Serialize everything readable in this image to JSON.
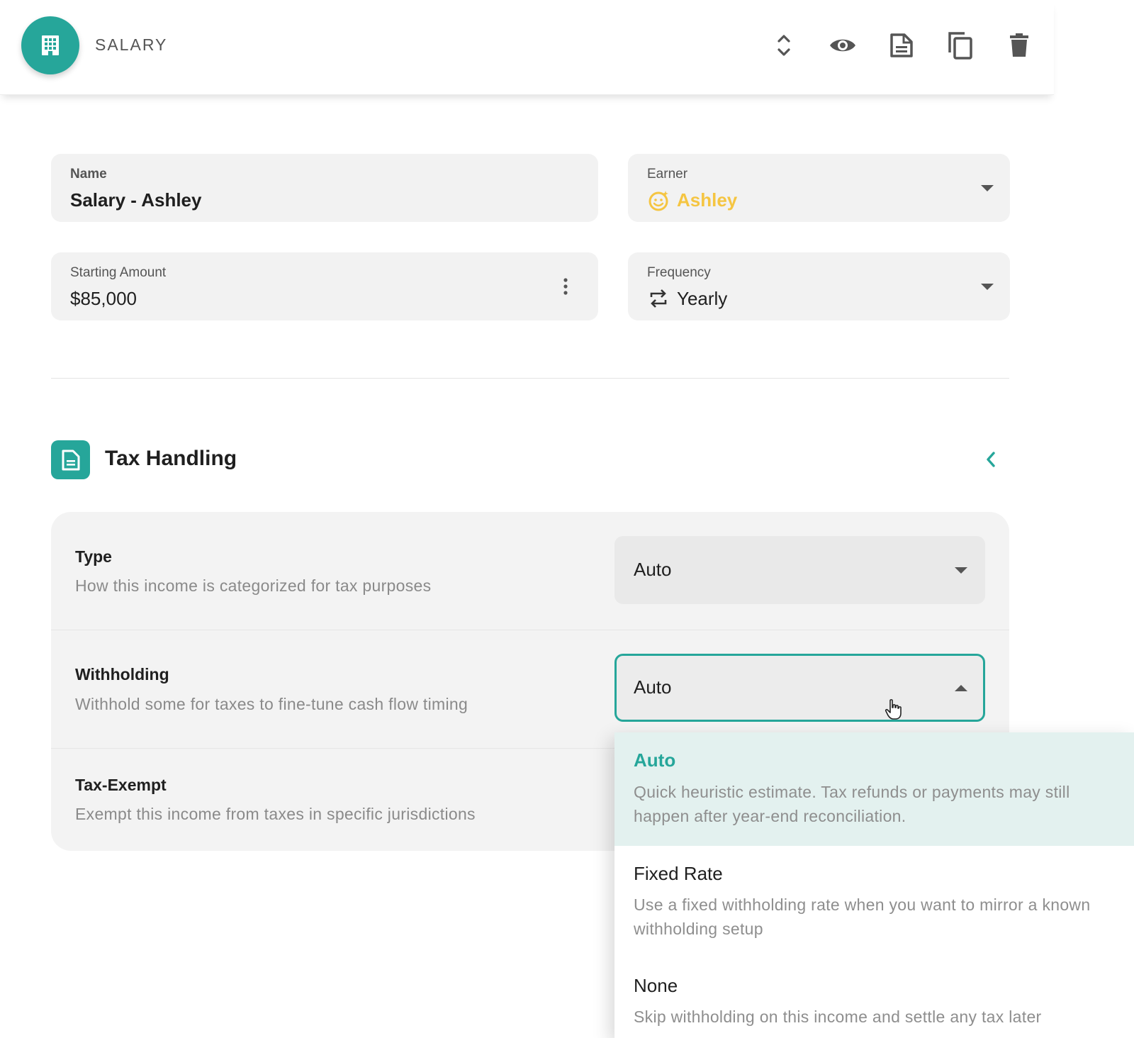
{
  "header": {
    "title": "SALARY",
    "app_icon": "building-icon",
    "actions": [
      {
        "name": "expand-collapse",
        "icon": "unfold-icon"
      },
      {
        "name": "preview",
        "icon": "eye-icon"
      },
      {
        "name": "notes",
        "icon": "document-icon"
      },
      {
        "name": "duplicate",
        "icon": "copy-icon"
      },
      {
        "name": "delete",
        "icon": "trash-icon"
      }
    ]
  },
  "form": {
    "name": {
      "label": "Name",
      "value": "Salary - Ashley"
    },
    "earner": {
      "label": "Earner",
      "value": "Ashley",
      "icon": "smiley-icon",
      "color": "#f5c542"
    },
    "starting_amount": {
      "label": "Starting Amount",
      "value": "$85,000"
    },
    "frequency": {
      "label": "Frequency",
      "value": "Yearly",
      "icon": "repeat-icon"
    }
  },
  "tax_handling": {
    "title": "Tax Handling",
    "rows": [
      {
        "title": "Type",
        "description": "How this income is categorized for tax purposes",
        "value": "Auto"
      },
      {
        "title": "Withholding",
        "description": "Withhold some for taxes to fine-tune cash flow timing",
        "value": "Auto"
      },
      {
        "title": "Tax-Exempt",
        "description": "Exempt this income from taxes in specific jurisdictions"
      }
    ]
  },
  "withholding_menu": {
    "options": [
      {
        "title": "Auto",
        "description": "Quick heuristic estimate. Tax refunds or payments may still happen after year-end reconciliation.",
        "selected": true
      },
      {
        "title": "Fixed Rate",
        "description": "Use a fixed withholding rate when you want to mirror a known withholding setup",
        "selected": false
      },
      {
        "title": "None",
        "description": "Skip withholding on this income and settle any tax later",
        "selected": false
      }
    ]
  },
  "colors": {
    "accent": "#26a69a",
    "earner": "#f5c542"
  }
}
